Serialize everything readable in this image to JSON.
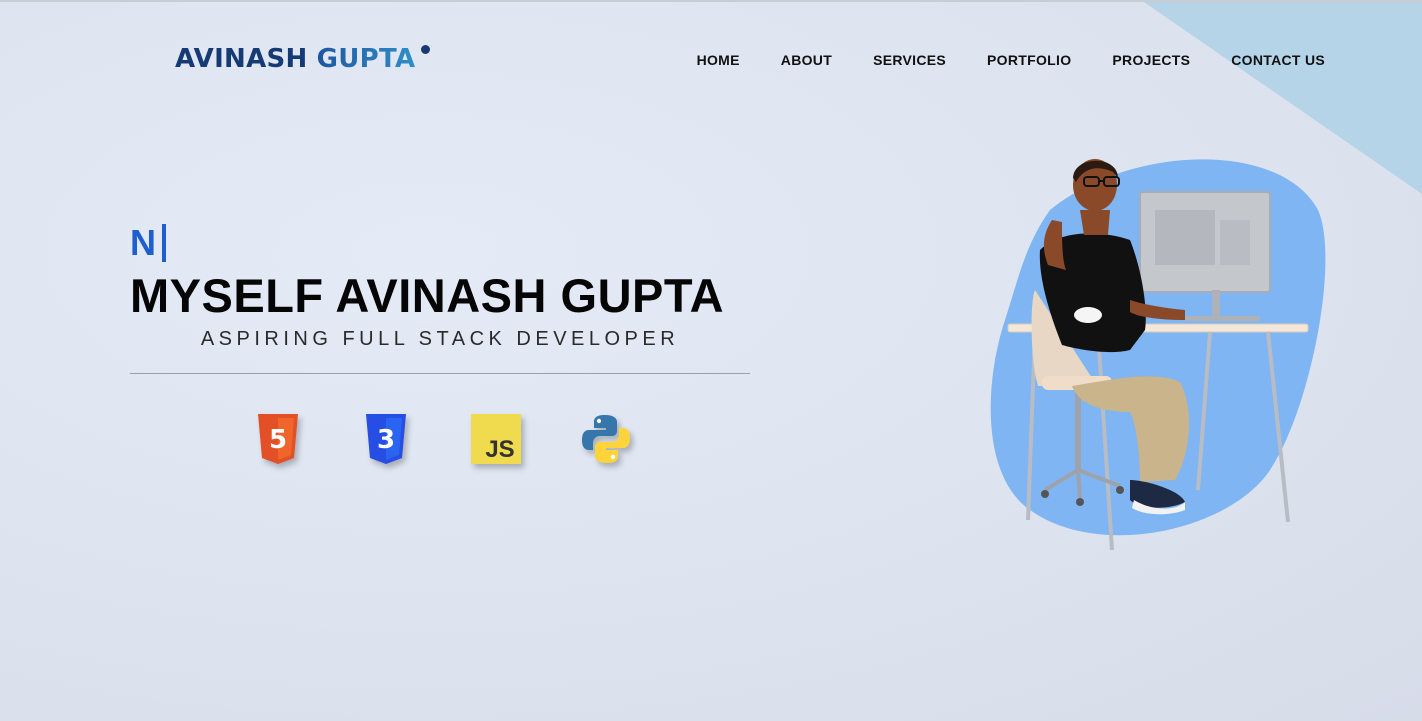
{
  "brand": {
    "first": "AVINASH",
    "last": "GUPTA"
  },
  "nav": {
    "items": [
      {
        "label": "HOME"
      },
      {
        "label": "ABOUT"
      },
      {
        "label": "SERVICES"
      },
      {
        "label": "PORTFOLIO"
      },
      {
        "label": "PROJECTS"
      },
      {
        "label": "CONTACT US"
      }
    ]
  },
  "hero": {
    "typed_text": "N",
    "name": "MYSELF AVINASH GUPTA",
    "role": "ASPIRING FULL STACK DEVELOPER"
  },
  "skills": [
    {
      "icon": "html5-icon",
      "label": "5"
    },
    {
      "icon": "css3-icon",
      "label": "3"
    },
    {
      "icon": "javascript-icon",
      "label": "JS"
    },
    {
      "icon": "python-icon"
    }
  ],
  "colors": {
    "brand_dark": "#163a73",
    "brand_light": "#2f8fc7",
    "accent_blue": "#1e5fd0",
    "blob": "#7eb5f2",
    "corner": "#b6d4e8"
  }
}
